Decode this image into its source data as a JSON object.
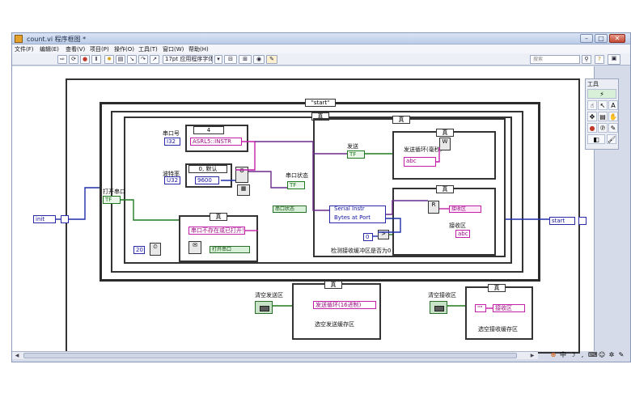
{
  "window": {
    "title": "count.vi 程序框图 *",
    "buttons": [
      "–",
      "□",
      "✕"
    ]
  },
  "menu": [
    "文件(F)",
    "编辑(E)",
    "查看(V)",
    "项目(P)",
    "操作(O)",
    "工具(T)",
    "窗口(W)",
    "帮助(H)"
  ],
  "toolbar": {
    "font": "17pt 应用程序字体",
    "search_placeholder": "搜索"
  },
  "palette": {
    "title": "工具"
  },
  "diagram": {
    "outer_selector": "\"start\"",
    "case_true": "真",
    "port_label": "串口号",
    "port_selector": "4",
    "resource": "ASRL5::INSTR",
    "baud_label": "波特率",
    "baud_selector": "0, 默认",
    "baud_value": "9600",
    "open_port_label": "打开串口",
    "serial_status_label": "串口状态",
    "serial_status_local": "串口状态",
    "send_label": "发送",
    "send_loop_label": "发送循环(毫秒)",
    "serial_instr": "Serial Instr",
    "bytes_at_port": "Bytes at Port",
    "recv_area_label": "接收区",
    "recv_area_local": "接收区",
    "detect_label": "检测接收缓冲区是否为0",
    "port_error_msg": "串口不存在或已打开！",
    "open_port_local": "打开串口",
    "zero_const": "0",
    "twenty_const": "20",
    "init_state": "init",
    "start_state": "start",
    "clear_send_label": "清空发送区",
    "clear_send_local": "发送循环(16进制)",
    "clear_send_caption": "选空发送缓存区",
    "clear_recv_label": "清空接收区",
    "clear_recv_local": "接收区",
    "clear_recv_caption": "选空接收缓存区"
  },
  "colors": {
    "wire_pink": "#c41fa8",
    "wire_blue": "#1f2fa8",
    "wire_green": "#1f7a1f",
    "wire_purple": "#6b2a8a"
  }
}
